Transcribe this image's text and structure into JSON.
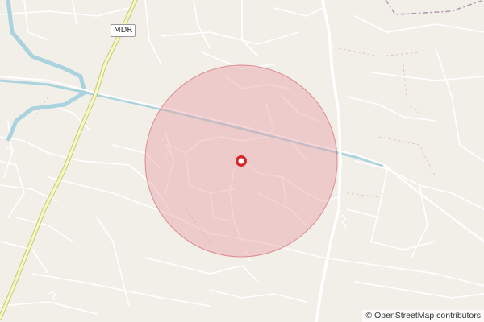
{
  "map": {
    "road_ref_label": "MDR",
    "attribution": {
      "symbol": "©",
      "link_text": "OpenStreetMap",
      "suffix": "contributors"
    },
    "colors": {
      "land": "#f2efe9",
      "minor_road": "#ffffff",
      "major_road": "#f7fabf",
      "major_road_casing": "#c7c97a",
      "waterway": "#aad3df",
      "radius_fill": "#e8a0a6",
      "radius_stroke": "#d46a74",
      "marker": "#d62828",
      "admin_boundary": "#b59ab5"
    }
  }
}
